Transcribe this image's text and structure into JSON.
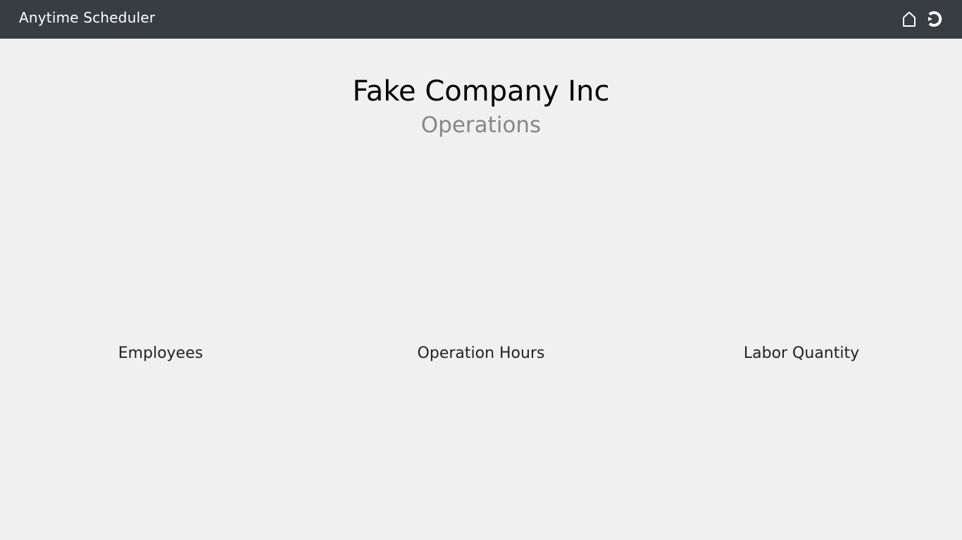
{
  "header": {
    "app_title": "Anytime Scheduler",
    "icons": [
      "home-icon",
      "logout-icon"
    ]
  },
  "main": {
    "company_name": "Fake Company Inc",
    "section_title": "Operations",
    "menu": [
      {
        "label": "Employees"
      },
      {
        "label": "Operation Hours"
      },
      {
        "label": "Labor Quantity"
      }
    ]
  },
  "colors": {
    "header_bg": "#383d42",
    "page_bg": "#f0f0f0",
    "section_title": "#878787"
  }
}
